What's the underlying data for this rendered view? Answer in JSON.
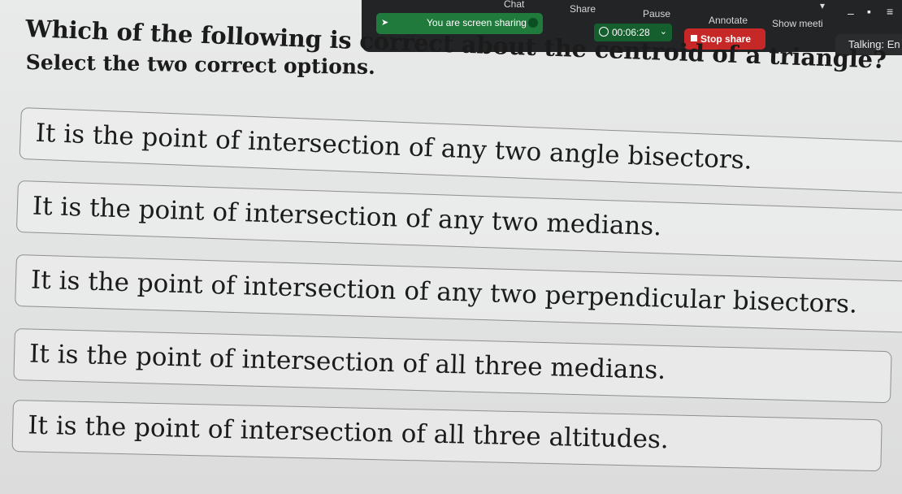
{
  "zoom_toolbar": {
    "sharing_notice": "You are screen sharing",
    "buttons": [
      "Chat",
      "Share",
      "Pause",
      "Annotate",
      "Show meeti"
    ],
    "timer": "00:06:28",
    "stop_share_label": "Stop share",
    "talking": "Talking: En"
  },
  "quiz": {
    "question": "Which of the following is correct about the centroid of a triangle?",
    "instruction": "Select the two correct options.",
    "options": [
      "It is the point of intersection of any two angle bisectors.",
      "It is the point of intersection of any two medians.",
      "It is the point of intersection of any two perpendicular bisectors.",
      "It is the point of intersection of all three medians.",
      "It is the point of intersection of all three altitudes."
    ]
  },
  "colors": {
    "toolbar_bg": "#222426",
    "sharing_green": "#1f7a3c",
    "stop_red": "#c62828",
    "page_bg": "#e6e7e7"
  }
}
